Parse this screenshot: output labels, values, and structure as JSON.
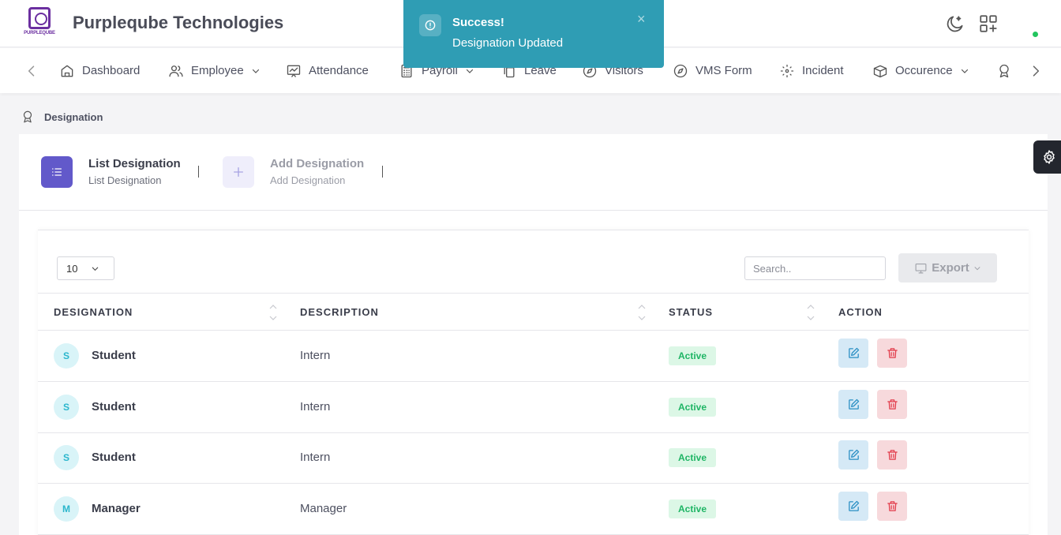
{
  "header": {
    "logo_text": "PURPLEQUBE",
    "company_name": "Purpleqube Technologies"
  },
  "nav": {
    "items": [
      {
        "label": "Dashboard",
        "icon": "home-icon"
      },
      {
        "label": "Employee",
        "icon": "users-icon",
        "dropdown": true
      },
      {
        "label": "Attendance",
        "icon": "presentation-chart-icon"
      },
      {
        "label": "Payroll",
        "icon": "calculator-icon",
        "dropdown": true
      },
      {
        "label": "Leave",
        "icon": "copy-icon"
      },
      {
        "label": "Visitors",
        "icon": "compass-icon"
      },
      {
        "label": "VMS Form",
        "icon": "compass-icon"
      },
      {
        "label": "Incident",
        "icon": "focus-icon"
      },
      {
        "label": "Occurence",
        "icon": "box-icon",
        "dropdown": true
      }
    ]
  },
  "toast": {
    "title": "Success!",
    "message": "Designation Updated",
    "close": "×"
  },
  "breadcrumb": {
    "label": "Designation"
  },
  "tabs": {
    "list": {
      "title": "List Designation",
      "subtitle": "List Designation"
    },
    "add": {
      "title": "Add Designation",
      "subtitle": "Add Designation"
    }
  },
  "table_controls": {
    "page_length": "10",
    "search_placeholder": "Search..",
    "export_label": "Export"
  },
  "table": {
    "columns": [
      "DESIGNATION",
      "DESCRIPTION",
      "STATUS",
      "ACTION"
    ],
    "rows": [
      {
        "initial": "S",
        "designation": "Student",
        "description": "Intern",
        "status": "Active"
      },
      {
        "initial": "S",
        "designation": "Student",
        "description": "Intern",
        "status": "Active"
      },
      {
        "initial": "S",
        "designation": "Student",
        "description": "Intern",
        "status": "Active"
      },
      {
        "initial": "M",
        "designation": "Manager",
        "description": "Manager",
        "status": "Active"
      }
    ]
  },
  "colors": {
    "brand": "#6b2fa0",
    "accent": "#6259ca",
    "toast": "#2f9db4",
    "status_active": "#1fb565"
  }
}
